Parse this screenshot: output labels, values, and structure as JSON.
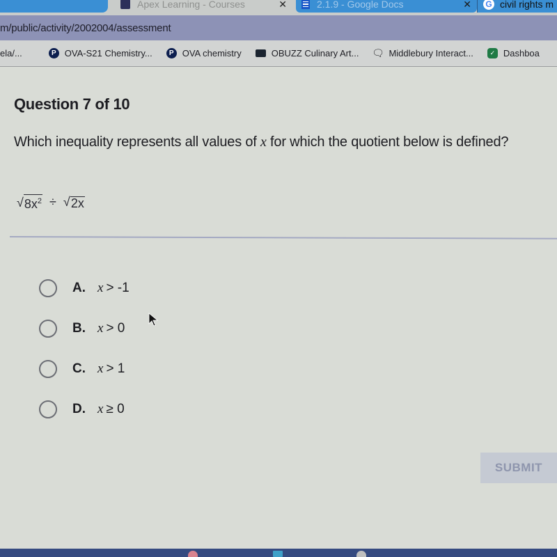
{
  "browser": {
    "tabs": [
      {
        "title": "",
        "active": false
      },
      {
        "title": "Apex Learning - Courses",
        "active": false,
        "close": "✕"
      },
      {
        "title": "2.1.9 - Google Docs",
        "active": false,
        "close": "✕"
      },
      {
        "title": "civil rights m",
        "active": false
      }
    ],
    "url": "m/public/activity/2002004/assessment",
    "bookmarks": [
      {
        "label": "ela/...",
        "icon": "none"
      },
      {
        "label": "OVA-S21 Chemistry...",
        "icon": "pearson-icon"
      },
      {
        "label": "OVA chemistry",
        "icon": "pearson-icon"
      },
      {
        "label": "OBUZZ Culinary Art...",
        "icon": "clapperboard-icon"
      },
      {
        "label": "Middlebury Interact...",
        "icon": "chat-icon"
      },
      {
        "label": "Dashboa",
        "icon": "shield-icon"
      }
    ]
  },
  "question": {
    "header": "Question 7 of 10",
    "prompt_before": "Which inequality represents all values of ",
    "prompt_var": "x",
    "prompt_after": " for which the quotient below is defined?",
    "expression": {
      "left_radicand": "8x",
      "left_exponent": "2",
      "operator": "÷",
      "right_radicand": "2x"
    },
    "options": [
      {
        "letter": "A.",
        "var": "x",
        "text": "> -1",
        "selected": false
      },
      {
        "letter": "B.",
        "var": "x",
        "text": "> 0",
        "selected": false
      },
      {
        "letter": "C.",
        "var": "x",
        "text": "> 1",
        "selected": false
      },
      {
        "letter": "D.",
        "var": "x",
        "text": "≥ 0",
        "selected": false
      }
    ],
    "submit_label": "SUBMIT"
  },
  "colors": {
    "accent_tab": "#3a8fd4",
    "address_bar": "#8d92b6",
    "submit_disabled_bg": "#c5cad3",
    "submit_disabled_text": "#8e95ad"
  }
}
